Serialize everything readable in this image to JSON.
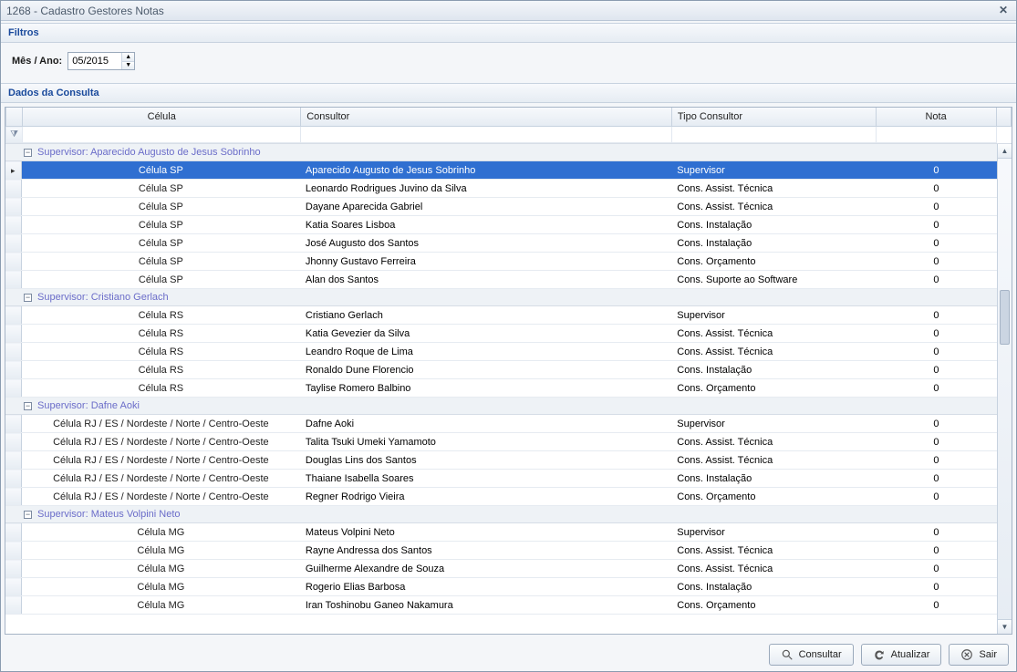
{
  "window": {
    "title": "1268 - Cadastro Gestores Notas"
  },
  "sections": {
    "filters": "Filtros",
    "data": "Dados da Consulta"
  },
  "filters": {
    "label": "Mês / Ano:",
    "value": "05/2015"
  },
  "columns": {
    "cell": "Célula",
    "consultant": "Consultor",
    "type": "Tipo Consultor",
    "note": "Nota"
  },
  "buttons": {
    "consult": "Consultar",
    "update": "Atualizar",
    "exit": "Sair"
  },
  "groups": [
    {
      "supervisor": "Aparecido Augusto de Jesus Sobrinho",
      "rows": [
        {
          "cell": "Célula SP",
          "consultant": "Aparecido Augusto de Jesus Sobrinho",
          "type": "Supervisor",
          "note": "0",
          "selected": true,
          "indicator": true
        },
        {
          "cell": "Célula SP",
          "consultant": "Leonardo Rodrigues Juvino da Silva",
          "type": "Cons. Assist. Técnica",
          "note": "0"
        },
        {
          "cell": "Célula SP",
          "consultant": "Dayane Aparecida Gabriel",
          "type": "Cons. Assist. Técnica",
          "note": "0"
        },
        {
          "cell": "Célula SP",
          "consultant": "Katia Soares Lisboa",
          "type": "Cons. Instalação",
          "note": "0"
        },
        {
          "cell": "Célula SP",
          "consultant": "José Augusto dos Santos",
          "type": "Cons. Instalação",
          "note": "0"
        },
        {
          "cell": "Célula SP",
          "consultant": "Jhonny Gustavo Ferreira",
          "type": "Cons. Orçamento",
          "note": "0"
        },
        {
          "cell": "Célula SP",
          "consultant": "Alan dos Santos",
          "type": "Cons. Suporte ao Software",
          "note": "0"
        }
      ]
    },
    {
      "supervisor": "Cristiano Gerlach",
      "rows": [
        {
          "cell": "Célula RS",
          "consultant": "Cristiano Gerlach",
          "type": "Supervisor",
          "note": "0"
        },
        {
          "cell": "Célula RS",
          "consultant": "Katia Gevezier da Silva",
          "type": "Cons. Assist. Técnica",
          "note": "0"
        },
        {
          "cell": "Célula RS",
          "consultant": "Leandro Roque de Lima",
          "type": "Cons. Assist. Técnica",
          "note": "0"
        },
        {
          "cell": "Célula RS",
          "consultant": "Ronaldo Dune Florencio",
          "type": "Cons. Instalação",
          "note": "0"
        },
        {
          "cell": "Célula RS",
          "consultant": "Taylise Romero Balbino",
          "type": "Cons. Orçamento",
          "note": "0"
        }
      ]
    },
    {
      "supervisor": "Dafne Aoki",
      "rows": [
        {
          "cell": "Célula RJ / ES / Nordeste / Norte / Centro-Oeste",
          "consultant": "Dafne Aoki",
          "type": "Supervisor",
          "note": "0"
        },
        {
          "cell": "Célula RJ / ES / Nordeste / Norte / Centro-Oeste",
          "consultant": "Talita Tsuki Umeki Yamamoto",
          "type": "Cons. Assist. Técnica",
          "note": "0"
        },
        {
          "cell": "Célula RJ / ES / Nordeste / Norte / Centro-Oeste",
          "consultant": "Douglas Lins dos Santos",
          "type": "Cons. Assist. Técnica",
          "note": "0"
        },
        {
          "cell": "Célula RJ / ES / Nordeste / Norte / Centro-Oeste",
          "consultant": "Thaiane Isabella Soares",
          "type": "Cons. Instalação",
          "note": "0"
        },
        {
          "cell": "Célula RJ / ES / Nordeste / Norte / Centro-Oeste",
          "consultant": "Regner Rodrigo Vieira",
          "type": "Cons. Orçamento",
          "note": "0"
        }
      ]
    },
    {
      "supervisor": "Mateus Volpini Neto",
      "rows": [
        {
          "cell": "Célula MG",
          "consultant": "Mateus Volpini Neto",
          "type": "Supervisor",
          "note": "0"
        },
        {
          "cell": "Célula MG",
          "consultant": "Rayne Andressa dos Santos",
          "type": "Cons. Assist. Técnica",
          "note": "0"
        },
        {
          "cell": "Célula MG",
          "consultant": "Guilherme Alexandre de Souza",
          "type": "Cons. Assist. Técnica",
          "note": "0"
        },
        {
          "cell": "Célula MG",
          "consultant": "Rogerio Elias Barbosa",
          "type": "Cons. Instalação",
          "note": "0"
        },
        {
          "cell": "Célula MG",
          "consultant": "Iran Toshinobu Ganeo Nakamura",
          "type": "Cons. Orçamento",
          "note": "0"
        }
      ]
    }
  ],
  "group_prefix": "Supervisor: "
}
